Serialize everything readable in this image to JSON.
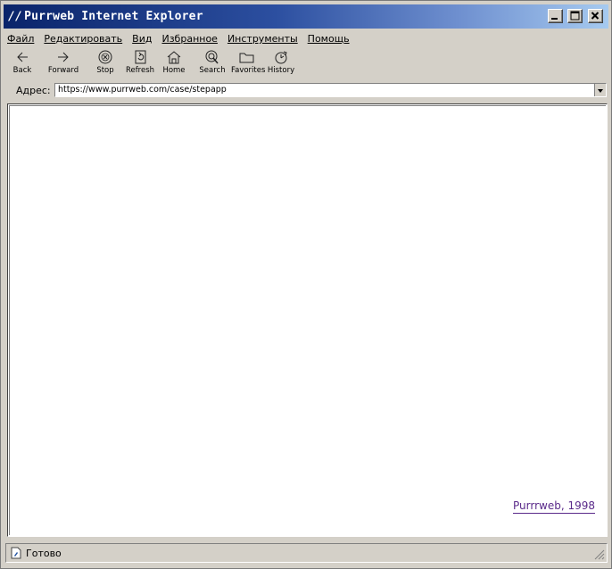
{
  "window": {
    "title_prefix": "//",
    "title": "Purrweb Internet Explorer"
  },
  "menu": [
    "Файл",
    "Редактировать",
    "Вид",
    "Избранное",
    "Инструменты",
    "Помощь"
  ],
  "toolbar": {
    "back": "Back",
    "forward": "Forward",
    "stop": "Stop",
    "refresh": "Refresh",
    "home": "Home",
    "search": "Search",
    "favorites": "Favorites",
    "history": "History"
  },
  "address": {
    "label": "Адрес:",
    "url": "https://www.purrweb.com/case/stepapp"
  },
  "content": {
    "credit": "Purrrweb, 1998"
  },
  "status": {
    "text": "Готово"
  },
  "colors": {
    "titlebar_start": "#0a246a",
    "titlebar_end": "#a6caf0",
    "chrome": "#d4d0c8",
    "credit_link": "#5a2a8a"
  },
  "icons": [
    "back-arrow-icon",
    "forward-arrow-icon",
    "stop-icon",
    "refresh-icon",
    "home-icon",
    "search-icon",
    "favorites-folder-icon",
    "history-icon",
    "page-icon",
    "resize-grip-icon"
  ]
}
